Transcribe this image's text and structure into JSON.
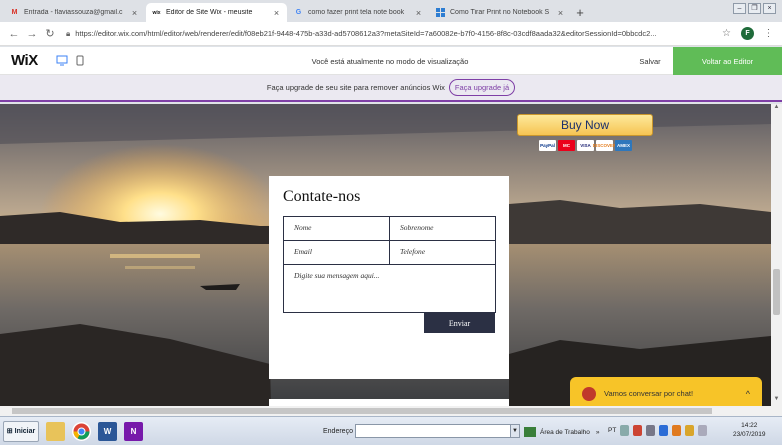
{
  "browser": {
    "tabs": [
      {
        "favicon": "gmail-icon",
        "title": "Entrada - flaviassouza@gmail.c",
        "active": false
      },
      {
        "favicon": "wix-icon",
        "title": "Editor de Site Wix - meusite",
        "active": true
      },
      {
        "favicon": "google-icon",
        "title": "como fazer print tela note book",
        "active": false
      },
      {
        "favicon": "windows-icon",
        "title": "Como Tirar Print no Notebook S",
        "active": false
      }
    ],
    "new_tab": "+",
    "url": "https://editor.wix.com/html/editor/web/renderer/edit/f08eb21f-9448-475b-a33d-ad5708612a3?metaSiteId=7a60082e-b7f0-4156-8f8c-03cdf8aada32&editorSessionId=0bbcdc2...",
    "avatar_letter": "F"
  },
  "wix": {
    "logo": "WiX",
    "preview_message": "Você está atualmente no modo de visualização",
    "save_label": "Salvar",
    "back_to_editor_label": "Voltar ao Editor",
    "upgrade_text": "Faça upgrade de seu site para remover anúncios Wix",
    "upgrade_link": "Faça upgrade já"
  },
  "site": {
    "buy_now": "Buy Now",
    "cards": [
      "PayPal",
      "MC",
      "VISA",
      "DISCOVER",
      "AMEX"
    ],
    "contact": {
      "title": "Contate-nos",
      "name_placeholder": "Nome",
      "surname_placeholder": "Sobrenome",
      "email_placeholder": "Email",
      "phone_placeholder": "Telefone",
      "message_placeholder": "Digite sua mensagem aqui...",
      "send_label": "Enviar"
    },
    "chat": {
      "text": "Vamos conversar por chat!",
      "toggle": "^"
    }
  },
  "taskbar": {
    "start_label": "Iniciar",
    "address_label": "Endereço",
    "desktop_label": "Área de Trabalho",
    "expand": "»",
    "language": "PT",
    "time": "14:22",
    "date": "23/07/2019"
  },
  "colors": {
    "wix_green": "#60bc57",
    "upgrade_purple": "#7e3fa6",
    "form_navy": "#2b3044",
    "chat_yellow": "#f7c428"
  }
}
